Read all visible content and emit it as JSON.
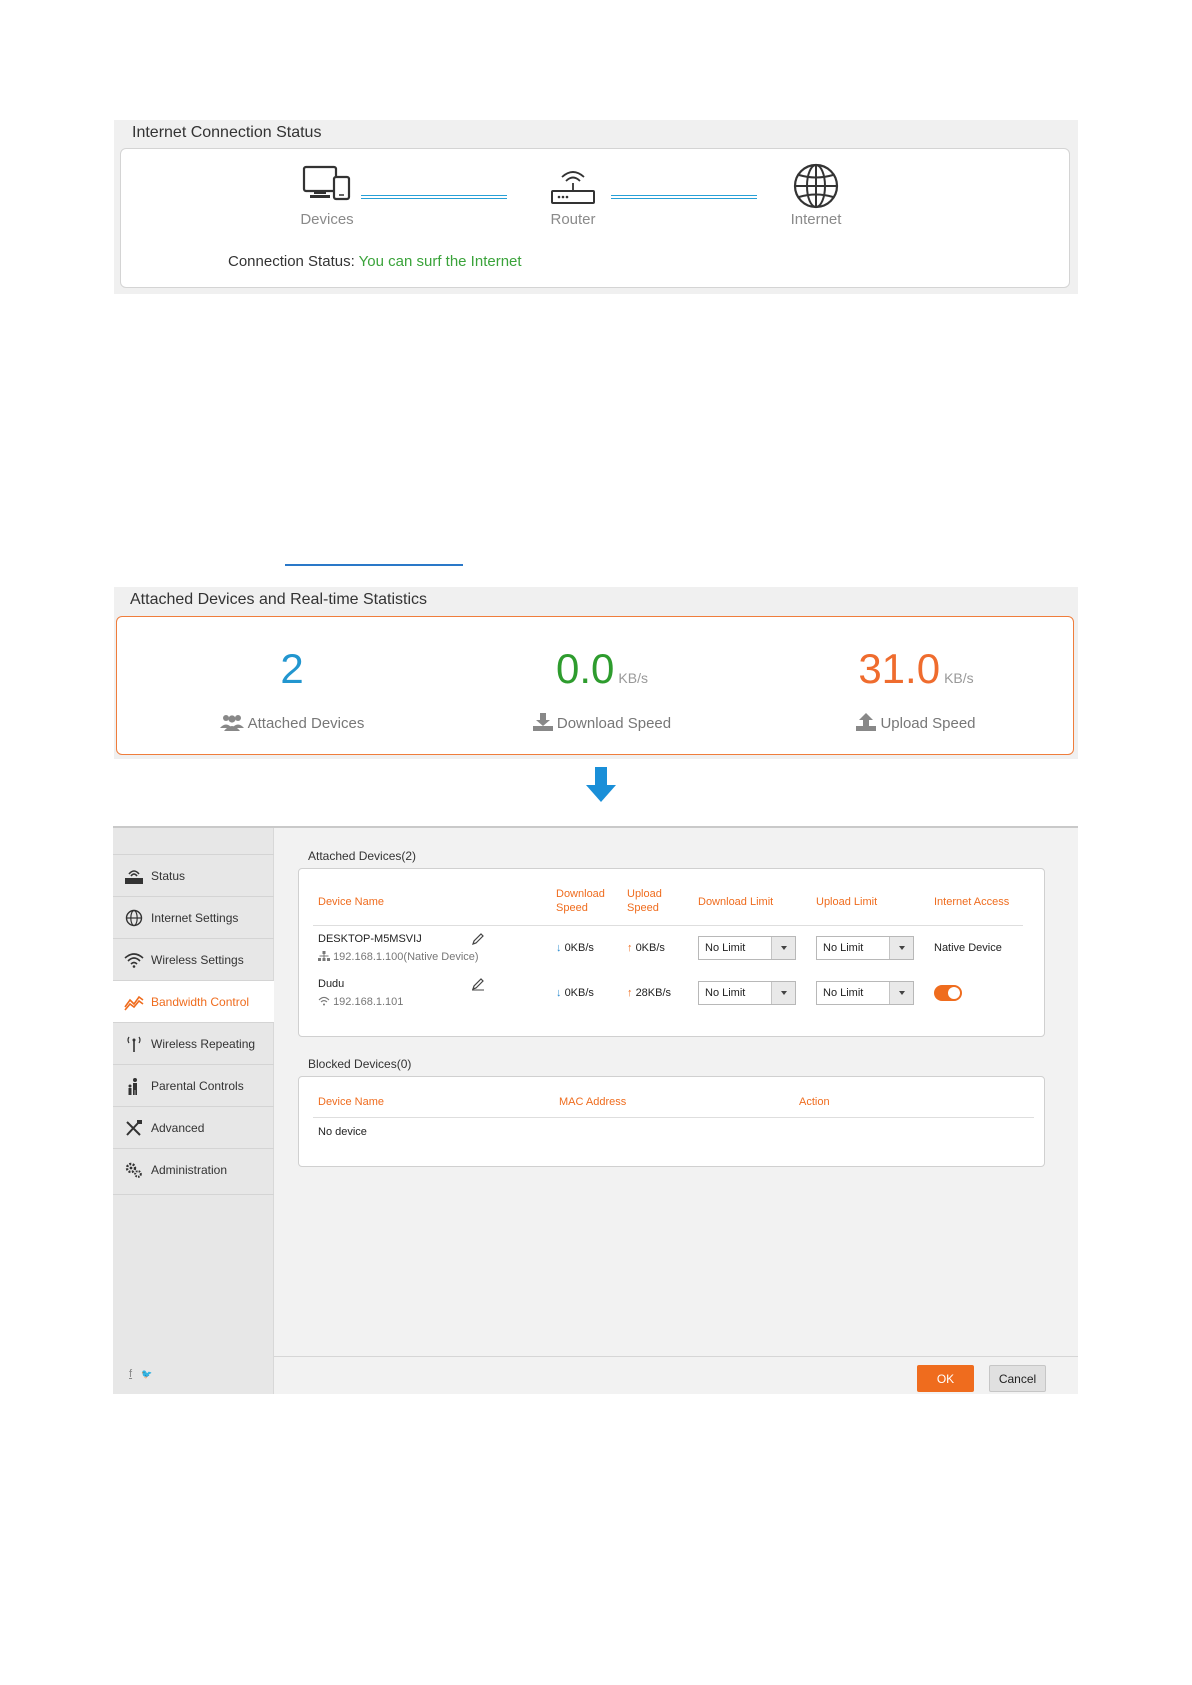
{
  "connection": {
    "title": "Internet Connection Status",
    "nodes": {
      "devices": "Devices",
      "router": "Router",
      "internet": "Internet"
    },
    "status_label": "Connection Status:",
    "status_value": "You can surf the Internet",
    "status_color": "#3aa33a"
  },
  "stats": {
    "title": "Attached Devices and Real-time Statistics",
    "attached": {
      "value": "2",
      "label": "Attached Devices",
      "color": "#2296cf"
    },
    "download": {
      "value": "0.0",
      "unit": "KB/s",
      "label": "Download Speed",
      "color": "#2e9c2e"
    },
    "upload": {
      "value": "31.0",
      "unit": "KB/s",
      "label": "Upload Speed",
      "color": "#ef6c2e"
    }
  },
  "sidebar": {
    "items": [
      {
        "label": "Status",
        "icon": "router-status-icon"
      },
      {
        "label": "Internet Settings",
        "icon": "globe-icon"
      },
      {
        "label": "Wireless Settings",
        "icon": "wifi-icon"
      },
      {
        "label": "Bandwidth Control",
        "icon": "bandwidth-icon",
        "active": true
      },
      {
        "label": "Wireless Repeating",
        "icon": "antenna-icon"
      },
      {
        "label": "Parental Controls",
        "icon": "parent-child-icon"
      },
      {
        "label": "Advanced",
        "icon": "tools-icon"
      },
      {
        "label": "Administration",
        "icon": "gears-icon"
      }
    ],
    "social": {
      "facebook": "f",
      "twitter": "🐦"
    }
  },
  "attached_devices": {
    "title": "Attached Devices(2)",
    "headers": {
      "device_name": "Device Name",
      "download_speed_1": "Download",
      "download_speed_2": "Speed",
      "upload_speed_1": "Upload",
      "upload_speed_2": "Speed",
      "download_limit": "Download Limit",
      "upload_limit": "Upload Limit",
      "internet_access": "Internet Access"
    },
    "rows": [
      {
        "name": "DESKTOP-M5MSVIJ",
        "ip": "192.168.1.100(Native Device)",
        "down_arrow": "↓",
        "down": "0KB/s",
        "up_arrow": "↑",
        "up": "0KB/s",
        "down_limit": "No Limit",
        "up_limit": "No Limit",
        "access": "Native Device"
      },
      {
        "name": "Dudu",
        "ip": "192.168.1.101",
        "down_arrow": "↓",
        "down": "0KB/s",
        "up_arrow": "↑",
        "up": "28KB/s",
        "down_limit": "No Limit",
        "up_limit": "No Limit",
        "access_enabled": true
      }
    ]
  },
  "blocked_devices": {
    "title": "Blocked Devices(0)",
    "headers": {
      "device_name": "Device Name",
      "mac_address": "MAC Address",
      "action": "Action"
    },
    "empty": "No device"
  },
  "footer": {
    "ok": "OK",
    "cancel": "Cancel"
  },
  "colors": {
    "accent": "#ef6c1e",
    "link_line": "#27a0d6",
    "arrow": "#1a8fd8"
  }
}
